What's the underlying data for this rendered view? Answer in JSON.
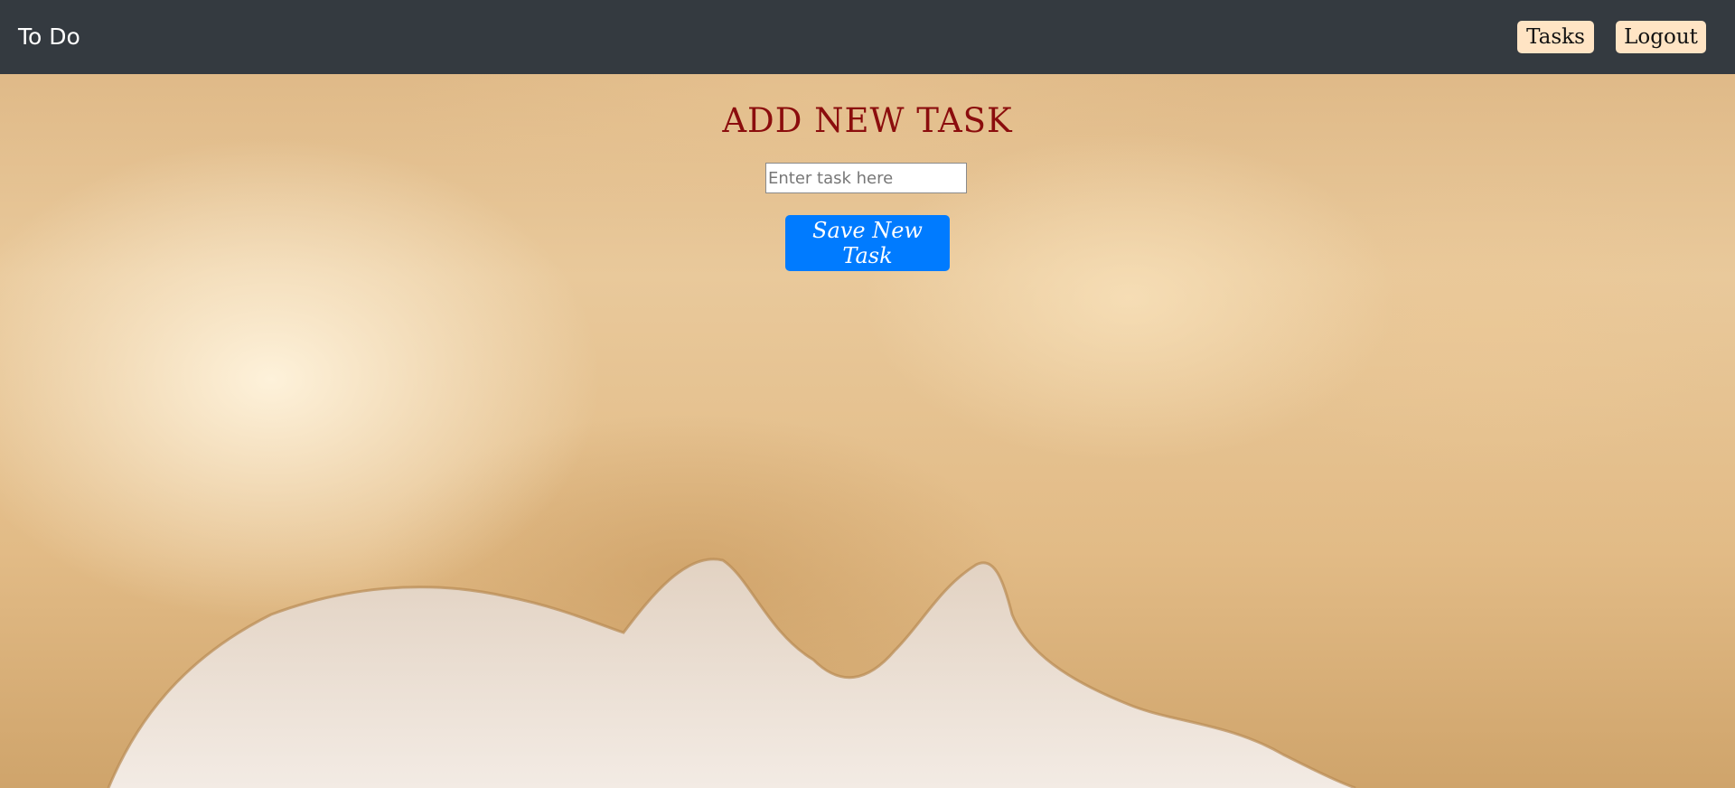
{
  "navbar": {
    "brand": "To Do",
    "tasks_label": "Tasks",
    "logout_label": "Logout"
  },
  "form": {
    "title": "ADD NEW TASK",
    "input_placeholder": "Enter task here",
    "input_value": "",
    "save_label": "Save New Task"
  },
  "colors": {
    "navbar_bg": "#343a40",
    "nav_button_bg": "#ffe4c4",
    "title_color": "#8b0d0d",
    "save_button_bg": "#007bff"
  }
}
